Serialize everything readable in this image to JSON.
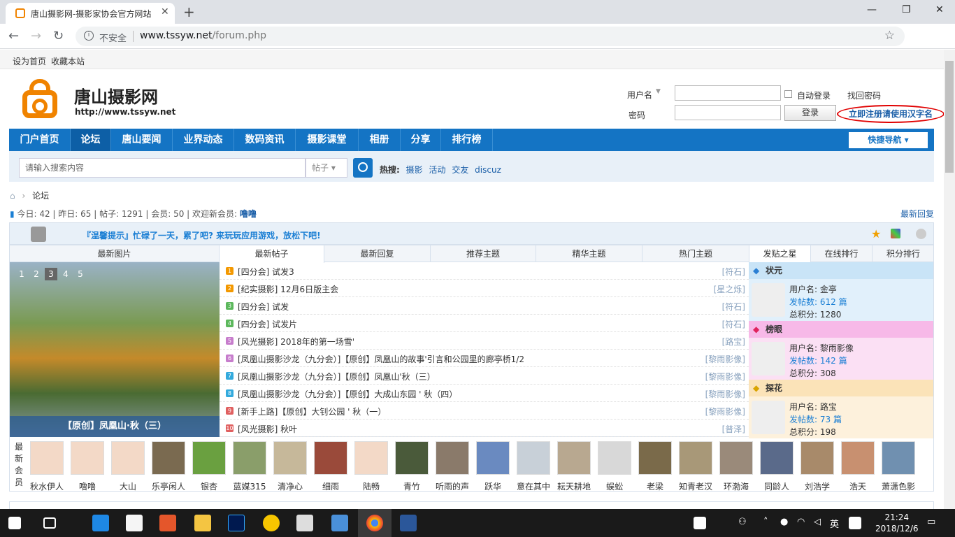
{
  "browser": {
    "tab_title": "唐山摄影网-摄影家协会官方网站",
    "insecure_label": "不安全",
    "url_host": "www.tssyw.net",
    "url_path": "/forum.php"
  },
  "topbar": {
    "set_home": "设为首页",
    "bookmark": "收藏本站"
  },
  "header": {
    "site_name": "唐山摄影网",
    "site_url": "http://www.tssyw.net",
    "username_label": "用户名",
    "password_label": "密码",
    "auto_login": "自动登录",
    "forgot_password": "找回密码",
    "login_button": "登录",
    "register_link": "立即注册请使用汉字名"
  },
  "nav": {
    "items": [
      "门户首页",
      "论坛",
      "唐山要闻",
      "业界动态",
      "数码资讯",
      "摄影课堂",
      "相册",
      "分享",
      "排行榜"
    ],
    "quick_nav": "快捷导航"
  },
  "search": {
    "placeholder": "请输入搜索内容",
    "type": "帖子",
    "hot_label": "热搜:",
    "hot_terms": [
      "摄影",
      "活动",
      "交友",
      "discuz"
    ]
  },
  "breadcrumb": {
    "current": "论坛"
  },
  "stats": {
    "today_label": "今日:",
    "today": "42",
    "yesterday_label": "昨日:",
    "yesterday": "65",
    "posts_label": "帖子:",
    "posts": "1291",
    "members_label": "会员:",
    "members": "50",
    "welcome_label": "欢迎新会员:",
    "new_member": "噜噜",
    "latest_reply": "最新回复"
  },
  "notice": {
    "text": "『温馨提示』忙碌了一天，累了吧? 来玩玩应用游戏，放松下吧!"
  },
  "gallery": {
    "title": "最新图片",
    "pages": [
      "1",
      "2",
      "3",
      "4",
      "5"
    ],
    "active_page": "3",
    "caption": "【原创】凤凰山·秋（三）"
  },
  "thread_tabs": [
    "最新帖子",
    "最新回复",
    "推荐主题",
    "精华主题",
    "热门主题"
  ],
  "threads": [
    {
      "num": "1",
      "color": "#f39800",
      "title": "[四分会] 试发3",
      "author": "[符石]"
    },
    {
      "num": "2",
      "color": "#f39800",
      "title": "[纪实摄影] 12月6日版主会",
      "author": "[星之烁]"
    },
    {
      "num": "3",
      "color": "#5cb85c",
      "title": "[四分会] 试发",
      "author": "[符石]"
    },
    {
      "num": "4",
      "color": "#5cb85c",
      "title": "[四分会] 试发片",
      "author": "[符石]"
    },
    {
      "num": "5",
      "color": "#c77dcc",
      "title": "[风光摄影] 2018年的第一场雪'",
      "author": "[路宝]"
    },
    {
      "num": "6",
      "color": "#c77dcc",
      "title": "[凤凰山摄影沙龙（九分会）]【原创】凤凰山的故事'引言和公园里的廊亭桥1/2",
      "author": "[黎雨影像]"
    },
    {
      "num": "7",
      "color": "#33aadd",
      "title": "[凤凰山摄影沙龙（九分会）]【原创】凤凰山'秋（三）",
      "author": "[黎雨影像]"
    },
    {
      "num": "8",
      "color": "#33aadd",
      "title": "[凤凰山摄影沙龙（九分会）]【原创】大成山东园 ' 秋（四）",
      "author": "[黎雨影像]"
    },
    {
      "num": "9",
      "color": "#e06060",
      "title": "[新手上路]【原创】大钊公园 ' 秋（一）",
      "author": "[黎雨影像]"
    },
    {
      "num": "10",
      "color": "#e06060",
      "title": "[风光摄影] 秋叶",
      "author": "[普泽]"
    }
  ],
  "star_tabs": [
    "发贴之星",
    "在线排行",
    "积分排行"
  ],
  "stars": [
    {
      "rank": "状元",
      "bg": "#c9e4f7",
      "body_bg": "#e1f0fb",
      "username": "用户名: 金亭",
      "posts": "发帖数: 612 篇",
      "points": "总积分: 1280"
    },
    {
      "rank": "榜眼",
      "bg": "#f7b9e8",
      "body_bg": "#fbe0f4",
      "username": "用户名: 黎雨影像",
      "posts": "发帖数: 142 篇",
      "points": "总积分: 308"
    },
    {
      "rank": "探花",
      "bg": "#fbe3b8",
      "body_bg": "#fdf1dc",
      "username": "用户名: 路宝",
      "posts": "发帖数: 73 篇",
      "points": "总积分: 198"
    }
  ],
  "new_members_label": "最新会员",
  "new_members": [
    "秋水伊人",
    "噜噜",
    "大山",
    "乐亭闲人",
    "银杏",
    "蓝媒315",
    "清净心",
    "细雨",
    "陆畅",
    "青竹",
    "听雨的声",
    "跃华",
    "意在其中",
    "耘天耕地",
    "蜈蚣",
    "老梁",
    "知青老汉",
    "环渤海",
    "同龄人",
    "刘浩学",
    "浩天",
    "萧潇色影"
  ],
  "taskbar": {
    "ime": "英",
    "time": "21:24",
    "date": "2018/12/6"
  }
}
